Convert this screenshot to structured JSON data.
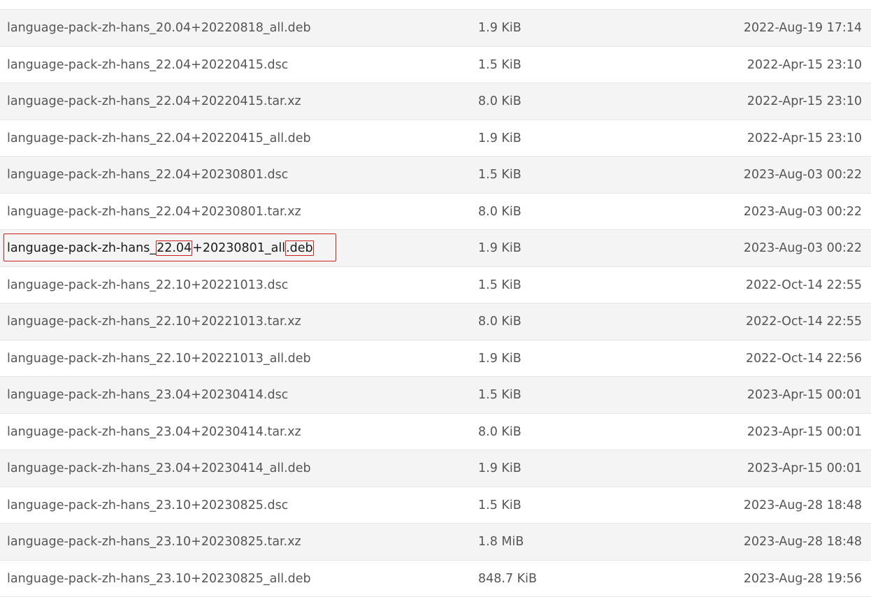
{
  "files": [
    {
      "name": "language-pack-zh-hans_20.04+20220818_all.deb",
      "size": "1.9 KiB",
      "date": "2022-Aug-19 17:14"
    },
    {
      "name": "language-pack-zh-hans_22.04+20220415.dsc",
      "size": "1.5 KiB",
      "date": "2022-Apr-15 23:10"
    },
    {
      "name": "language-pack-zh-hans_22.04+20220415.tar.xz",
      "size": "8.0 KiB",
      "date": "2022-Apr-15 23:10"
    },
    {
      "name": "language-pack-zh-hans_22.04+20220415_all.deb",
      "size": "1.9 KiB",
      "date": "2022-Apr-15 23:10"
    },
    {
      "name": "language-pack-zh-hans_22.04+20230801.dsc",
      "size": "1.5 KiB",
      "date": "2023-Aug-03 00:22"
    },
    {
      "name": "language-pack-zh-hans_22.04+20230801.tar.xz",
      "size": "8.0 KiB",
      "date": "2023-Aug-03 00:22"
    },
    {
      "name": "language-pack-zh-hans_22.04+20230801_all.deb",
      "size": "1.9 KiB",
      "date": "2023-Aug-03 00:22",
      "name_parts": {
        "prefix": "language-pack-zh-hans_",
        "version": "22.04",
        "middle": "+20230801_all",
        "ext": ".deb"
      }
    },
    {
      "name": "language-pack-zh-hans_22.10+20221013.dsc",
      "size": "1.5 KiB",
      "date": "2022-Oct-14 22:55"
    },
    {
      "name": "language-pack-zh-hans_22.10+20221013.tar.xz",
      "size": "8.0 KiB",
      "date": "2022-Oct-14 22:55"
    },
    {
      "name": "language-pack-zh-hans_22.10+20221013_all.deb",
      "size": "1.9 KiB",
      "date": "2022-Oct-14 22:56"
    },
    {
      "name": "language-pack-zh-hans_23.04+20230414.dsc",
      "size": "1.5 KiB",
      "date": "2023-Apr-15 00:01"
    },
    {
      "name": "language-pack-zh-hans_23.04+20230414.tar.xz",
      "size": "8.0 KiB",
      "date": "2023-Apr-15 00:01"
    },
    {
      "name": "language-pack-zh-hans_23.04+20230414_all.deb",
      "size": "1.9 KiB",
      "date": "2023-Apr-15 00:01"
    },
    {
      "name": "language-pack-zh-hans_23.10+20230825.dsc",
      "size": "1.5 KiB",
      "date": "2023-Aug-28 18:48"
    },
    {
      "name": "language-pack-zh-hans_23.10+20230825.tar.xz",
      "size": "1.8 MiB",
      "date": "2023-Aug-28 18:48"
    },
    {
      "name": "language-pack-zh-hans_23.10+20230825_all.deb",
      "size": "848.7 KiB",
      "date": "2023-Aug-28 19:56"
    }
  ],
  "colors": {
    "row_alt": "#f4f4f4",
    "text": "#555555",
    "highlight_box": "#cc1f1f"
  }
}
